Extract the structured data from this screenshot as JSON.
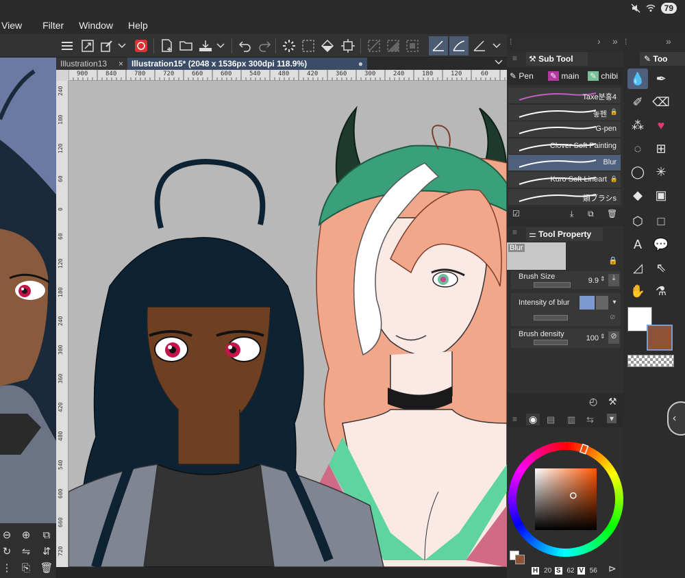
{
  "status": {
    "battery": "79"
  },
  "menu": {
    "items": [
      "View",
      "Filter",
      "Window",
      "Help"
    ]
  },
  "tabs": [
    {
      "label": "Illustration13",
      "close": "×"
    },
    {
      "label": "Illustration15* (2048 x 1536px 300dpi 118.9%)",
      "close": "●"
    }
  ],
  "ruler_h_labels": [
    "900",
    "840",
    "780",
    "720",
    "660",
    "600",
    "540",
    "480",
    "420",
    "360",
    "300",
    "240",
    "180",
    "120",
    "60"
  ],
  "ruler_v_labels": [
    "240",
    "180",
    "120",
    "60",
    "0",
    "60",
    "120",
    "180",
    "240",
    "300",
    "360",
    "420",
    "480",
    "540",
    "600",
    "660",
    "720"
  ],
  "subtool": {
    "title": "Sub Tool",
    "tabs": [
      "Pen",
      "main",
      "chibi"
    ],
    "brushes": [
      {
        "name": "Taxe분홍4",
        "locked": false,
        "stroke": "#c060c0"
      },
      {
        "name": "놓펜",
        "locked": true,
        "stroke": "#ffffff"
      },
      {
        "name": "G-pen",
        "locked": false,
        "stroke": "#ffffff"
      },
      {
        "name": "Clover Soft Painting",
        "locked": false,
        "stroke": "#ffffff"
      },
      {
        "name": "Blur",
        "locked": false,
        "stroke": "#ffffff",
        "selected": true
      },
      {
        "name": "Kuro Soft Lineart",
        "locked": true,
        "stroke": "#ffffff"
      },
      {
        "name": "類ブラシs",
        "locked": false,
        "stroke": "#ffffff"
      }
    ]
  },
  "toolprop": {
    "title": "Tool Property",
    "preview_label": "Blur",
    "brush_size_label": "Brush Size",
    "brush_size_value": "9.9",
    "intensity_label": "Intensity of blur",
    "density_label": "Brush density",
    "density_value": "100"
  },
  "color": {
    "h_label": "H",
    "h_value": "20",
    "s_label": "S",
    "s_value": "62",
    "v_label": "V",
    "v_value": "56",
    "main_color": "#ffffff",
    "sub_color": "#8f5336",
    "hue_color": "#d9541e"
  },
  "tool_palette": {
    "title": "Too"
  },
  "icons": {
    "menu": "hamburger-icon",
    "undo": "undo-icon",
    "redo": "redo-icon",
    "mute": "mute-icon",
    "wifi": "wifi-icon"
  }
}
